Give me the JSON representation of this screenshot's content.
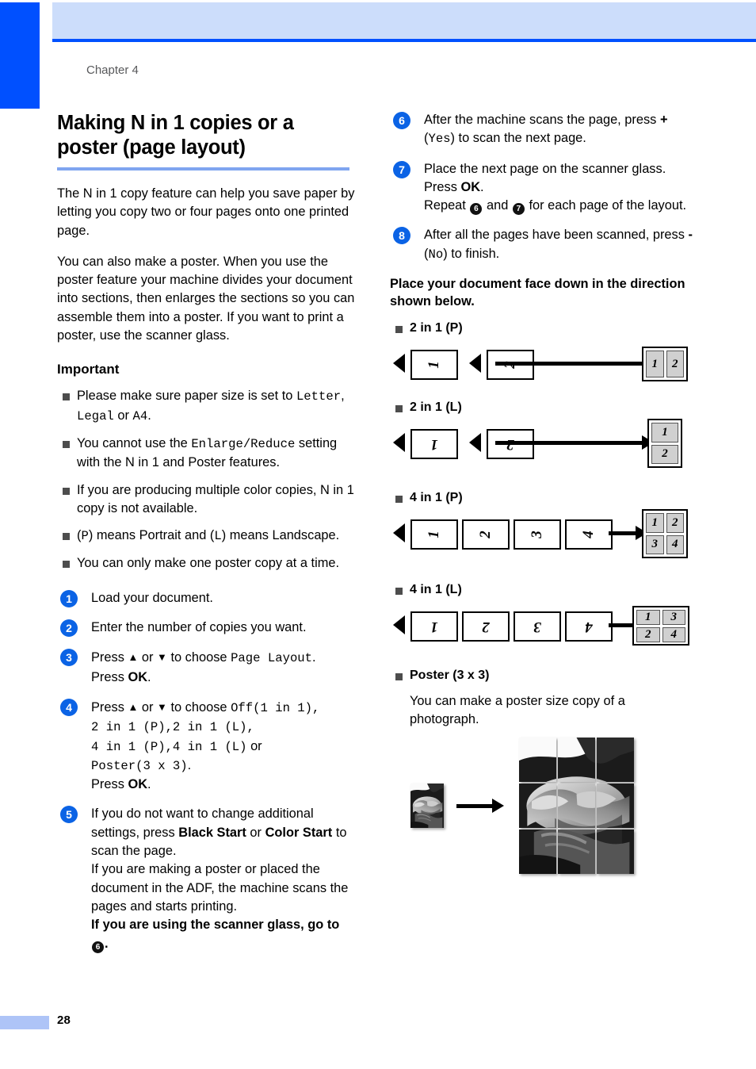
{
  "page": {
    "chapter_label": "Chapter 4",
    "page_number": "28",
    "accent_blue": "#0050ff",
    "header_band": "#ccddfb",
    "rule_blue": "#7fa5f0",
    "step_circle": "#0b63e5"
  },
  "left": {
    "title": "Making N in 1 copies or a poster (page layout)",
    "intro1": "The N in 1 copy feature can help you save paper by letting you copy two or four pages onto one printed page.",
    "intro2": "You can also make a poster. When you use the poster feature your machine divides your document into sections, then enlarges the sections so you can assemble them into a poster. If you want to print a poster, use the scanner glass.",
    "important_heading": "Important",
    "bullets": [
      {
        "parts": [
          {
            "t": "Please make sure paper size is set to ",
            "s": "plain"
          },
          {
            "t": "Letter",
            "s": "mono"
          },
          {
            "t": ", ",
            "s": "plain"
          },
          {
            "t": "Legal",
            "s": "mono"
          },
          {
            "t": " or ",
            "s": "plain"
          },
          {
            "t": "A4",
            "s": "mono"
          },
          {
            "t": ".",
            "s": "plain"
          }
        ]
      },
      {
        "parts": [
          {
            "t": "You cannot use the ",
            "s": "plain"
          },
          {
            "t": "Enlarge/Reduce",
            "s": "mono"
          },
          {
            "t": " setting with the N in 1 and Poster features.",
            "s": "plain"
          }
        ]
      },
      {
        "parts": [
          {
            "t": "If you are producing multiple color copies, N in 1 copy is not available.",
            "s": "plain"
          }
        ]
      },
      {
        "parts": [
          {
            "t": "(",
            "s": "plain"
          },
          {
            "t": "P",
            "s": "mono"
          },
          {
            "t": ") means Portrait and (",
            "s": "plain"
          },
          {
            "t": "L",
            "s": "mono"
          },
          {
            "t": ") means Landscape.",
            "s": "plain"
          }
        ]
      },
      {
        "parts": [
          {
            "t": "You can only make one poster copy at a time.",
            "s": "plain"
          }
        ]
      }
    ],
    "steps": [
      {
        "num": "1",
        "parts": [
          {
            "t": "Load your document.",
            "s": "plain"
          }
        ]
      },
      {
        "num": "2",
        "parts": [
          {
            "t": "Enter the number of copies you want.",
            "s": "plain"
          }
        ]
      },
      {
        "num": "3",
        "parts": [
          {
            "t": "Press ",
            "s": "plain"
          },
          {
            "t": "▲",
            "s": "key"
          },
          {
            "t": " or ",
            "s": "plain"
          },
          {
            "t": "▼",
            "s": "key"
          },
          {
            "t": " to choose ",
            "s": "plain"
          },
          {
            "t": "Page Layout",
            "s": "mono"
          },
          {
            "t": ".",
            "s": "plain"
          },
          {
            "t": "\n",
            "s": "br"
          },
          {
            "t": "Press ",
            "s": "plain"
          },
          {
            "t": "OK",
            "s": "bold"
          },
          {
            "t": ".",
            "s": "plain"
          }
        ]
      },
      {
        "num": "4",
        "parts": [
          {
            "t": "Press ",
            "s": "plain"
          },
          {
            "t": "▲",
            "s": "key"
          },
          {
            "t": " or ",
            "s": "plain"
          },
          {
            "t": "▼",
            "s": "key"
          },
          {
            "t": " to choose ",
            "s": "plain"
          },
          {
            "t": "Off(1 in 1),",
            "s": "mono"
          },
          {
            "t": "\n",
            "s": "br"
          },
          {
            "t": "2 in 1 (P),2 in 1 (L),",
            "s": "mono"
          },
          {
            "t": "\n",
            "s": "br"
          },
          {
            "t": "4 in 1 (P),4 in 1 (L)",
            "s": "mono"
          },
          {
            "t": " or",
            "s": "plain"
          },
          {
            "t": "\n",
            "s": "br"
          },
          {
            "t": "Poster(3 x 3)",
            "s": "mono"
          },
          {
            "t": ".",
            "s": "plain"
          },
          {
            "t": "\n",
            "s": "br"
          },
          {
            "t": "Press ",
            "s": "plain"
          },
          {
            "t": "OK",
            "s": "bold"
          },
          {
            "t": ".",
            "s": "plain"
          }
        ]
      },
      {
        "num": "5",
        "parts": [
          {
            "t": "If you do not want to change additional settings, press ",
            "s": "plain"
          },
          {
            "t": "Black Start",
            "s": "bold"
          },
          {
            "t": " or ",
            "s": "plain"
          },
          {
            "t": "Color Start",
            "s": "bold"
          },
          {
            "t": " to scan the page.",
            "s": "plain"
          },
          {
            "t": "\n",
            "s": "br"
          },
          {
            "t": "If you are making a poster or placed the document in the ADF, the machine scans the pages and starts printing.",
            "s": "plain"
          },
          {
            "t": "\n",
            "s": "br"
          },
          {
            "t": "If you are using the scanner glass, go to ",
            "s": "bold"
          },
          {
            "t": "6",
            "s": "circle"
          },
          {
            "t": ".",
            "s": "bold"
          }
        ]
      }
    ]
  },
  "right": {
    "steps": [
      {
        "num": "6",
        "parts": [
          {
            "t": "After the machine scans the page, press ",
            "s": "plain"
          },
          {
            "t": "+",
            "s": "bold"
          },
          {
            "t": " (",
            "s": "plain"
          },
          {
            "t": "Yes",
            "s": "mono"
          },
          {
            "t": ") to scan the next page.",
            "s": "plain"
          }
        ]
      },
      {
        "num": "7",
        "parts": [
          {
            "t": "Place the next page on the scanner glass.",
            "s": "plain"
          },
          {
            "t": "\n",
            "s": "br"
          },
          {
            "t": "Press ",
            "s": "plain"
          },
          {
            "t": "OK",
            "s": "bold"
          },
          {
            "t": ".",
            "s": "plain"
          },
          {
            "t": "\n",
            "s": "br"
          },
          {
            "t": "Repeat ",
            "s": "plain"
          },
          {
            "t": "6",
            "s": "circle"
          },
          {
            "t": " and ",
            "s": "plain"
          },
          {
            "t": "7",
            "s": "circle"
          },
          {
            "t": " for each page of the layout.",
            "s": "plain"
          }
        ]
      },
      {
        "num": "8",
        "parts": [
          {
            "t": "After all the pages have been scanned, press ",
            "s": "plain"
          },
          {
            "t": "-",
            "s": "bold"
          },
          {
            "t": " (",
            "s": "plain"
          },
          {
            "t": "No",
            "s": "mono"
          },
          {
            "t": ") to finish.",
            "s": "plain"
          }
        ]
      }
    ],
    "place_heading": "Place your document face down in the direction shown below.",
    "layouts": [
      {
        "label": "2 in 1 (P)",
        "pages": [
          "1",
          "2"
        ],
        "result_cells": [
          "1",
          "2"
        ],
        "result_cols": 2,
        "result_rows": 1
      },
      {
        "label": "2 in 1 (L)",
        "pages": [
          "1",
          "2"
        ],
        "result_cells": [
          "1",
          "2"
        ],
        "result_cols": 1,
        "result_rows": 2
      },
      {
        "label": "4 in 1 (P)",
        "pages": [
          "1",
          "2",
          "3",
          "4"
        ],
        "result_cells": [
          "1",
          "2",
          "3",
          "4"
        ],
        "result_cols": 2,
        "result_rows": 2
      },
      {
        "label": "4 in 1 (L)",
        "pages": [
          "1",
          "2",
          "3",
          "4"
        ],
        "result_cells": [
          "1",
          "3",
          "2",
          "4"
        ],
        "result_cols": 2,
        "result_rows": 2
      }
    ],
    "poster": {
      "label": "Poster (3 x 3)",
      "description": "You can make a poster size copy of a photograph."
    }
  }
}
